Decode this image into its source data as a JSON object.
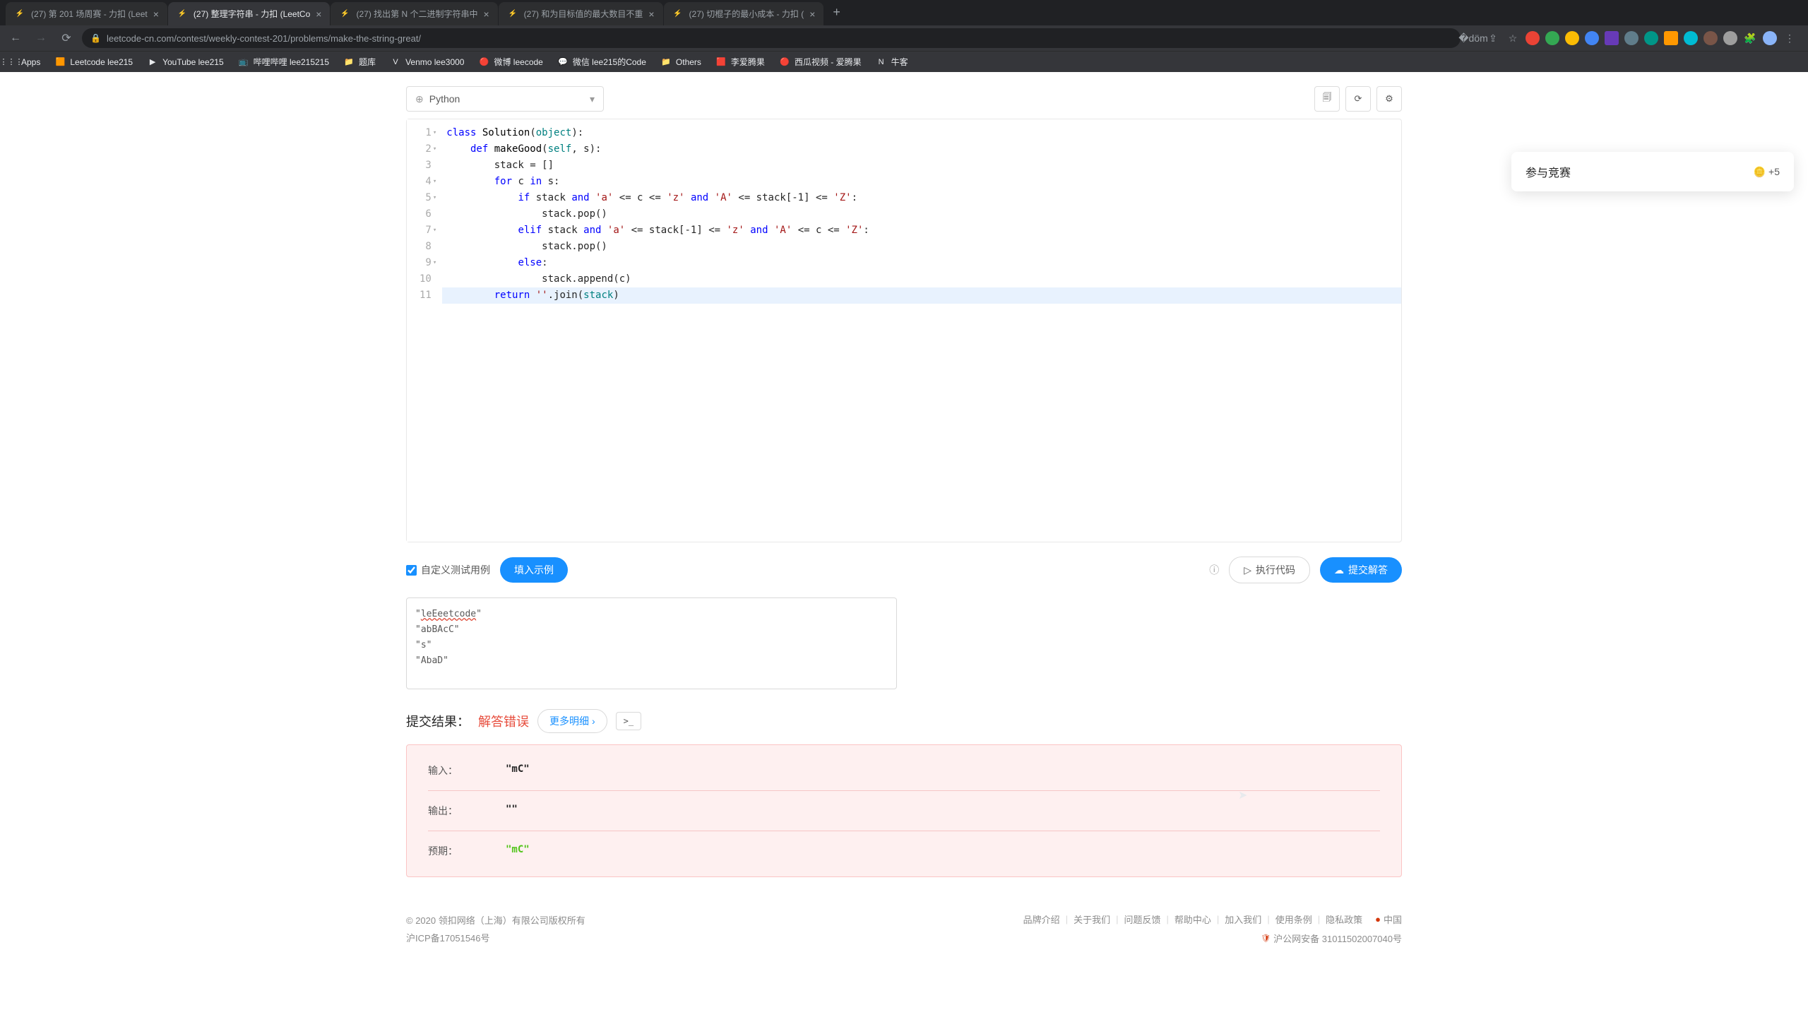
{
  "browser": {
    "tabs": [
      {
        "title": "(27) 第 201 场周赛 - 力扣 (Leet",
        "active": false
      },
      {
        "title": "(27) 整理字符串 - 力扣 (LeetCo",
        "active": true
      },
      {
        "title": "(27) 找出第 N 个二进制字符串中",
        "active": false
      },
      {
        "title": "(27) 和为目标值的最大数目不重",
        "active": false
      },
      {
        "title": "(27) 切棍子的最小成本 - 力扣 (",
        "active": false
      }
    ],
    "url": "leetcode-cn.com/contest/weekly-contest-201/problems/make-the-string-great/",
    "bookmarks": [
      {
        "label": "Apps",
        "icon": "⋮⋮⋮"
      },
      {
        "label": "Leetcode lee215",
        "icon": "🟧"
      },
      {
        "label": "YouTube lee215",
        "icon": "▶"
      },
      {
        "label": "哔哩哔哩 lee215215",
        "icon": "📺"
      },
      {
        "label": "题库",
        "icon": "📁"
      },
      {
        "label": "Venmo lee3000",
        "icon": "V"
      },
      {
        "label": "微博 leecode",
        "icon": "🔴"
      },
      {
        "label": "微信 lee215的Code",
        "icon": "💬"
      },
      {
        "label": "Others",
        "icon": "📁"
      },
      {
        "label": "李爱腾果",
        "icon": "🟥"
      },
      {
        "label": "西瓜视频 - 爱腾果",
        "icon": "🔴"
      },
      {
        "label": "牛客",
        "icon": "N"
      }
    ]
  },
  "editor": {
    "language": "Python",
    "lines": [
      {
        "n": 1,
        "fold": true,
        "html": "<span class='kw'>class</span> <span class='fn'>Solution</span>(<span class='builtin'>object</span>):"
      },
      {
        "n": 2,
        "fold": true,
        "html": "    <span class='kw'>def</span> <span class='fn'>makeGood</span>(<span class='builtin'>self</span>, s):"
      },
      {
        "n": 3,
        "fold": false,
        "html": "        stack = []"
      },
      {
        "n": 4,
        "fold": true,
        "html": "        <span class='kw'>for</span> c <span class='kw'>in</span> s:"
      },
      {
        "n": 5,
        "fold": true,
        "html": "            <span class='kw'>if</span> stack <span class='kw'>and</span> <span class='str'>'a'</span> <= c <= <span class='str'>'z'</span> <span class='kw'>and</span> <span class='str'>'A'</span> <= stack[-1] <= <span class='str'>'Z'</span>:"
      },
      {
        "n": 6,
        "fold": false,
        "html": "                stack.pop()"
      },
      {
        "n": 7,
        "fold": true,
        "html": "            <span class='kw'>elif</span> stack <span class='kw'>and</span> <span class='str'>'a'</span> <= stack[-1] <= <span class='str'>'z'</span> <span class='kw'>and</span> <span class='str'>'A'</span> <= c <= <span class='str'>'Z'</span>:"
      },
      {
        "n": 8,
        "fold": false,
        "html": "                stack.pop()"
      },
      {
        "n": 9,
        "fold": true,
        "html": "            <span class='kw'>else</span>:"
      },
      {
        "n": 10,
        "fold": false,
        "html": "                stack.append(c)"
      },
      {
        "n": 11,
        "fold": false,
        "html": "        <span class='kw'>return</span> <span class='str'>''</span>.join(<span class='builtin'>stack</span>)",
        "highlighted": true
      }
    ]
  },
  "controls": {
    "custom_test_label": "自定义测试用例",
    "fill_example_label": "填入示例",
    "run_code_label": "执行代码",
    "submit_label": "提交解答"
  },
  "testcase": {
    "lines": [
      "\"leEeetcode\"",
      "\"abBAcC\"",
      "\"s\"",
      "\"AbaD\""
    ]
  },
  "result": {
    "header_label": "提交结果：",
    "status": "解答错误",
    "detail_link": "更多明细",
    "console_label": ">_",
    "rows": [
      {
        "key": "输入：",
        "val": "\"mC\"",
        "green": false
      },
      {
        "key": "输出：",
        "val": "\"\"",
        "green": false
      },
      {
        "key": "预期：",
        "val": "\"mC\"",
        "green": true
      }
    ]
  },
  "footer": {
    "copyright": "© 2020 领扣网络（上海）有限公司版权所有",
    "icp": "沪ICP备17051546号",
    "beian": "沪公网安备 31011502007040号",
    "links": [
      "品牌介绍",
      "关于我们",
      "问题反馈",
      "帮助中心",
      "加入我们",
      "使用条例",
      "隐私政策"
    ],
    "region": "中国"
  },
  "float": {
    "title": "参与竞赛",
    "points": "+5"
  }
}
